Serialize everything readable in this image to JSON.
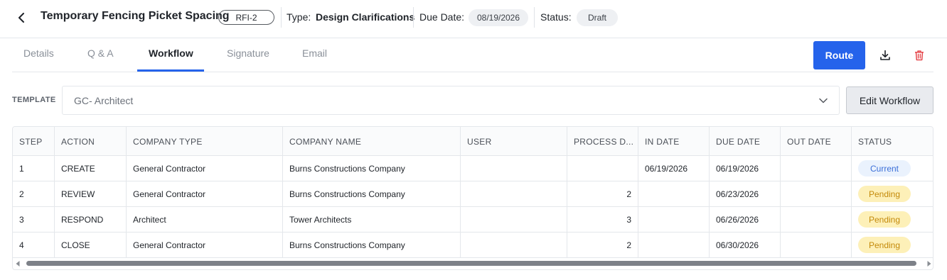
{
  "header": {
    "title": "Temporary Fencing Picket Spacing",
    "rfi_id": "RFI-2",
    "type_label": "Type:",
    "type_value": "Design Clarifications",
    "due_label": "Due Date:",
    "due_value": "08/19/2026",
    "status_label": "Status:",
    "status_value": "Draft",
    "icons": {
      "back": "chevron-left-icon"
    }
  },
  "tabs": [
    {
      "label": "Details",
      "active": false
    },
    {
      "label": "Q & A",
      "active": false
    },
    {
      "label": "Workflow",
      "active": true
    },
    {
      "label": "Signature",
      "active": false
    },
    {
      "label": "Email",
      "active": false
    }
  ],
  "actions": {
    "route_label": "Route",
    "icons": {
      "download": "download-icon",
      "delete": "trash-icon"
    },
    "colors": {
      "primary": "#2563eb",
      "danger": "#e5484d"
    }
  },
  "template": {
    "label": "TEMPLATE",
    "value": "GC- Architect",
    "edit_label": "Edit Workflow"
  },
  "table": {
    "columns": [
      "STEP",
      "ACTION",
      "COMPANY TYPE",
      "COMPANY NAME",
      "USER",
      "PROCESS D...",
      "IN DATE",
      "DUE DATE",
      "OUT DATE",
      "STATUS"
    ],
    "rows": [
      {
        "step": "1",
        "action": "CREATE",
        "company_type": "General Contractor",
        "company_name": "Burns Constructions Company",
        "user": "",
        "process_days": "",
        "in_date": "06/19/2026",
        "due_date": "06/19/2026",
        "out_date": "",
        "status": "Current"
      },
      {
        "step": "2",
        "action": "REVIEW",
        "company_type": "General Contractor",
        "company_name": "Burns Constructions Company",
        "user": "",
        "process_days": "2",
        "in_date": "",
        "due_date": "06/23/2026",
        "out_date": "",
        "status": "Pending"
      },
      {
        "step": "3",
        "action": "RESPOND",
        "company_type": "Architect",
        "company_name": "Tower Architects",
        "user": "",
        "process_days": "3",
        "in_date": "",
        "due_date": "06/26/2026",
        "out_date": "",
        "status": "Pending"
      },
      {
        "step": "4",
        "action": "CLOSE",
        "company_type": "General Contractor",
        "company_name": "Burns Constructions Company",
        "user": "",
        "process_days": "2",
        "in_date": "",
        "due_date": "06/30/2026",
        "out_date": "",
        "status": "Pending"
      }
    ],
    "status_colors": {
      "Current": "#3b6fd8",
      "Pending": "#c48a0a"
    }
  }
}
